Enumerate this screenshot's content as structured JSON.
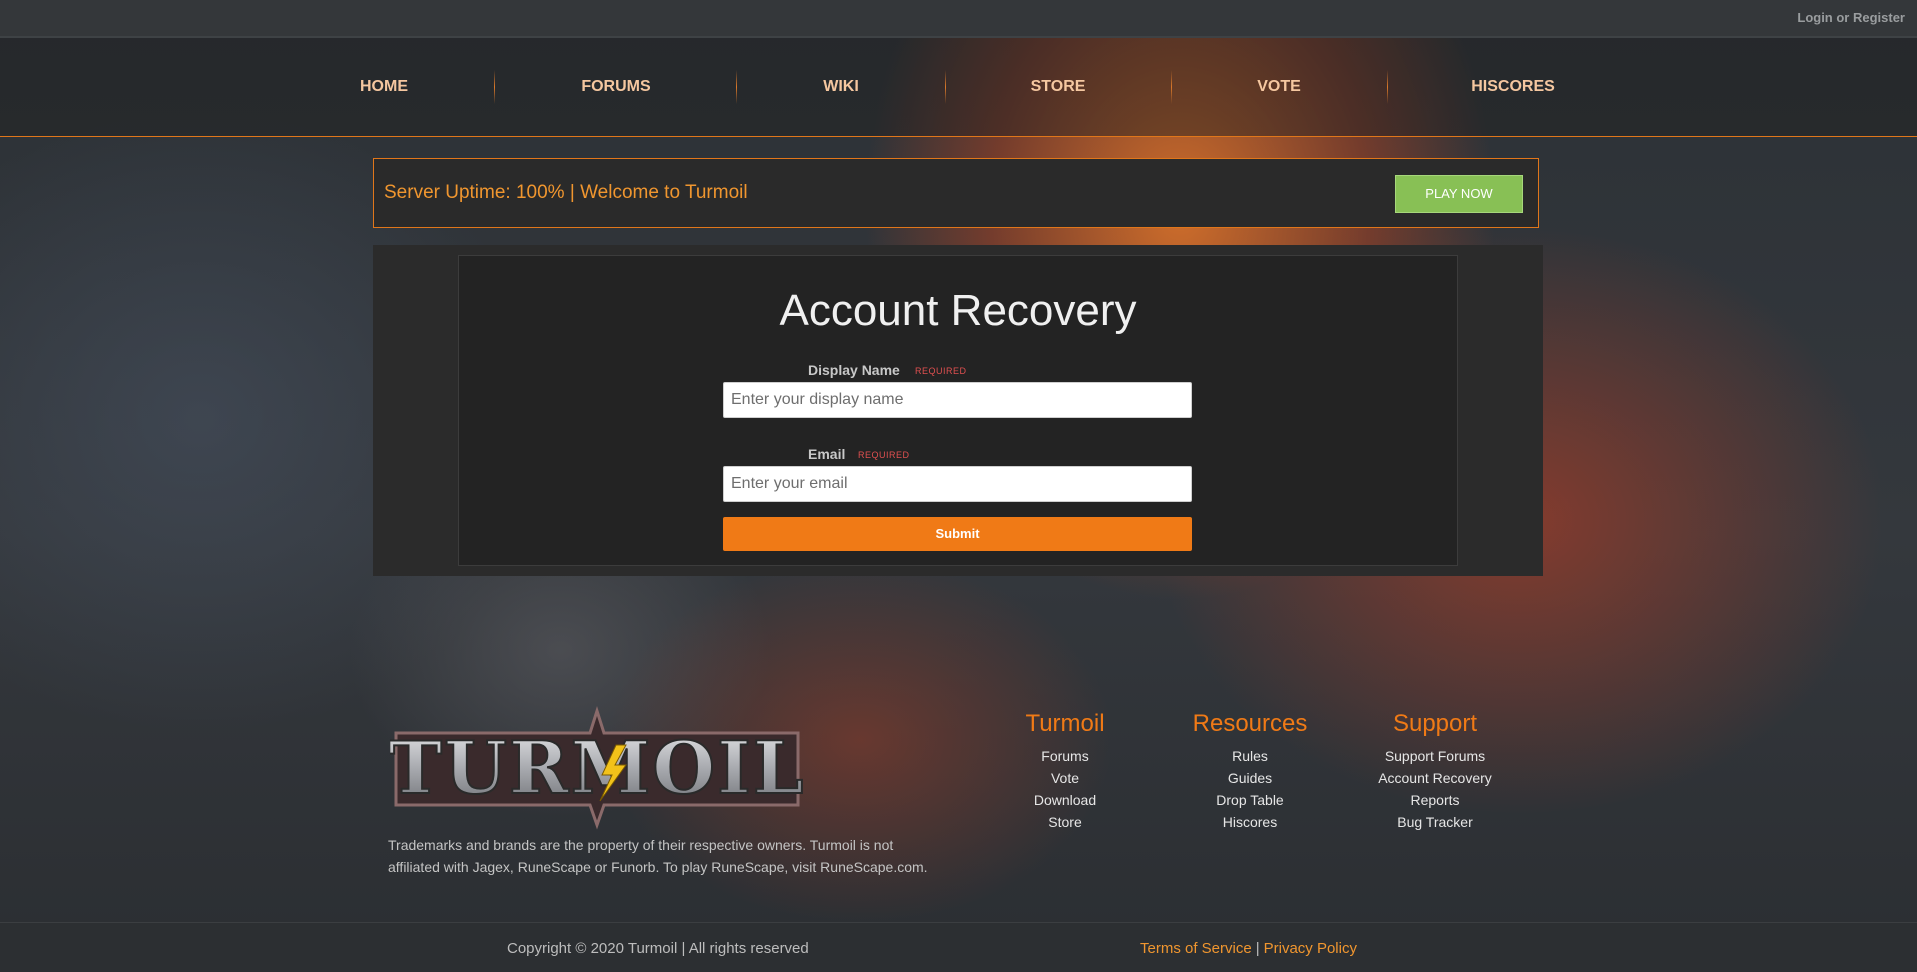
{
  "topbar": {
    "login_label": "Login or Register"
  },
  "nav": {
    "items": [
      {
        "label": "HOME"
      },
      {
        "label": "FORUMS"
      },
      {
        "label": "WIKI"
      },
      {
        "label": "STORE"
      },
      {
        "label": "VOTE"
      },
      {
        "label": "HISCORES"
      }
    ]
  },
  "banner": {
    "text": "Server Uptime: 100% | Welcome to Turmoil",
    "play_label": "PLAY NOW"
  },
  "recovery": {
    "title": "Account Recovery",
    "display_name": {
      "label": "Display Name",
      "required": "REQUIRED",
      "placeholder": "Enter your display name",
      "value": ""
    },
    "email": {
      "label": "Email",
      "required": "REQUIRED",
      "placeholder": "Enter your email",
      "value": ""
    },
    "submit_label": "Submit"
  },
  "footer": {
    "logo_text": "TURMOIL",
    "note_line1": "Trademarks and brands are the property of their respective owners. Turmoil is not",
    "note_line2": "affiliated with Jagex, RuneScape or Funorb. To play RuneScape, visit RuneScape.com.",
    "columns": [
      {
        "title": "Turmoil",
        "links": [
          "Forums",
          "Vote",
          "Download",
          "Store"
        ]
      },
      {
        "title": "Resources",
        "links": [
          "Rules",
          "Guides",
          "Drop Table",
          "Hiscores"
        ]
      },
      {
        "title": "Support",
        "links": [
          "Support Forums",
          "Account Recovery",
          "Reports",
          "Bug Tracker"
        ]
      }
    ],
    "copyright": "Copyright © 2020 Turmoil | All rights reserved",
    "terms_label": "Terms of Service",
    "separator": "|",
    "privacy_label": "Privacy Policy"
  },
  "colors": {
    "accent": "#f07a16",
    "play_button": "#88c055",
    "banner_text": "#f0962f"
  }
}
